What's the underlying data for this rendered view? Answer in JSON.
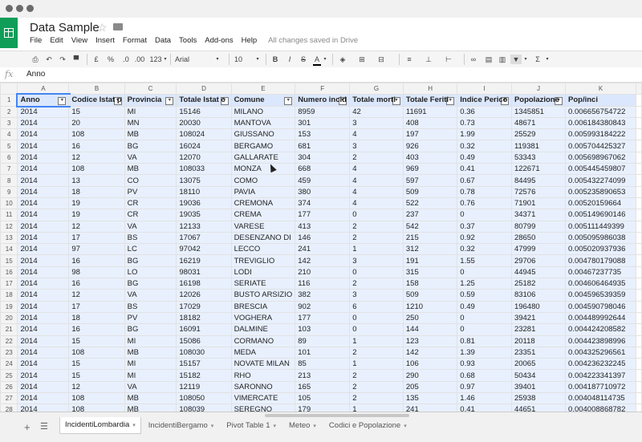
{
  "document": {
    "title": "Data Sample",
    "saved_status": "All changes saved in Drive"
  },
  "menu": [
    "File",
    "Edit",
    "View",
    "Insert",
    "Format",
    "Data",
    "Tools",
    "Add-ons",
    "Help"
  ],
  "toolbar": {
    "currency": "£",
    "percent": "%",
    "decrease_decimals": ".0",
    "increase_decimals": ".00",
    "more_formats": "123",
    "font": "Arial",
    "font_size": "10",
    "bold": "B",
    "italic": "I",
    "strikethrough": "S",
    "text_color": "A",
    "sum": "Σ",
    "accent_color": "#0f9d58"
  },
  "formula_bar": {
    "fx_label": "fx",
    "value": "Anno"
  },
  "grid": {
    "column_letters": [
      "A",
      "B",
      "C",
      "D",
      "E",
      "F",
      "G",
      "H",
      "I",
      "J",
      "K"
    ],
    "headers": [
      "Anno",
      "Codice Istat p",
      "Provincia",
      "Totale Istat c",
      "Comune",
      "Numero incid",
      "Totale morti",
      "Totale Feriti",
      "Indice Perico",
      "Popolazione",
      "Pop/inci"
    ],
    "rows": [
      [
        "2014",
        "15",
        "MI",
        "15146",
        "MILANO",
        "8959",
        "42",
        "11691",
        "0.36",
        "1345851",
        "0.006656754722"
      ],
      [
        "2014",
        "20",
        "MN",
        "20030",
        "MANTOVA",
        "301",
        "3",
        "408",
        "0.73",
        "48671",
        "0.006184380843"
      ],
      [
        "2014",
        "108",
        "MB",
        "108024",
        "GIUSSANO",
        "153",
        "4",
        "197",
        "1.99",
        "25529",
        "0.005993184222"
      ],
      [
        "2014",
        "16",
        "BG",
        "16024",
        "BERGAMO",
        "681",
        "3",
        "926",
        "0.32",
        "119381",
        "0.005704425327"
      ],
      [
        "2014",
        "12",
        "VA",
        "12070",
        "GALLARATE",
        "304",
        "2",
        "403",
        "0.49",
        "53343",
        "0.005698967062"
      ],
      [
        "2014",
        "108",
        "MB",
        "108033",
        "MONZA",
        "668",
        "4",
        "969",
        "0.41",
        "122671",
        "0.005445459807"
      ],
      [
        "2014",
        "13",
        "CO",
        "13075",
        "COMO",
        "459",
        "4",
        "597",
        "0.67",
        "84495",
        "0.005432274099"
      ],
      [
        "2014",
        "18",
        "PV",
        "18110",
        "PAVIA",
        "380",
        "4",
        "509",
        "0.78",
        "72576",
        "0.005235890653"
      ],
      [
        "2014",
        "19",
        "CR",
        "19036",
        "CREMONA",
        "374",
        "4",
        "522",
        "0.76",
        "71901",
        "0.00520159664"
      ],
      [
        "2014",
        "19",
        "CR",
        "19035",
        "CREMA",
        "177",
        "0",
        "237",
        "0",
        "34371",
        "0.005149690146"
      ],
      [
        "2014",
        "12",
        "VA",
        "12133",
        "VARESE",
        "413",
        "2",
        "542",
        "0.37",
        "80799",
        "0.005111449399"
      ],
      [
        "2014",
        "17",
        "BS",
        "17067",
        "DESENZANO DI",
        "146",
        "2",
        "215",
        "0.92",
        "28650",
        "0.005095986038"
      ],
      [
        "2014",
        "97",
        "LC",
        "97042",
        "LECCO",
        "241",
        "1",
        "312",
        "0.32",
        "47999",
        "0.005020937936"
      ],
      [
        "2014",
        "16",
        "BG",
        "16219",
        "TREVIGLIO",
        "142",
        "3",
        "191",
        "1.55",
        "29706",
        "0.004780179088"
      ],
      [
        "2014",
        "98",
        "LO",
        "98031",
        "LODI",
        "210",
        "0",
        "315",
        "0",
        "44945",
        "0.00467237735"
      ],
      [
        "2014",
        "16",
        "BG",
        "16198",
        "SERIATE",
        "116",
        "2",
        "158",
        "1.25",
        "25182",
        "0.004606464935"
      ],
      [
        "2014",
        "12",
        "VA",
        "12026",
        "BUSTO ARSIZIO",
        "382",
        "3",
        "509",
        "0.59",
        "83106",
        "0.004596539359"
      ],
      [
        "2014",
        "17",
        "BS",
        "17029",
        "BRESCIA",
        "902",
        "6",
        "1210",
        "0.49",
        "196480",
        "0.004590798046"
      ],
      [
        "2014",
        "18",
        "PV",
        "18182",
        "VOGHERA",
        "177",
        "0",
        "250",
        "0",
        "39421",
        "0.004489992644"
      ],
      [
        "2014",
        "16",
        "BG",
        "16091",
        "DALMINE",
        "103",
        "0",
        "144",
        "0",
        "23281",
        "0.004424208582"
      ],
      [
        "2014",
        "15",
        "MI",
        "15086",
        "CORMANO",
        "89",
        "1",
        "123",
        "0.81",
        "20118",
        "0.004423898996"
      ],
      [
        "2014",
        "108",
        "MB",
        "108030",
        "MEDA",
        "101",
        "2",
        "142",
        "1.39",
        "23351",
        "0.004325296561"
      ],
      [
        "2014",
        "15",
        "MI",
        "15157",
        "NOVATE MILAN",
        "85",
        "1",
        "106",
        "0.93",
        "20065",
        "0.004236232245"
      ],
      [
        "2014",
        "15",
        "MI",
        "15182",
        "RHO",
        "213",
        "2",
        "290",
        "0.68",
        "50434",
        "0.004223341397"
      ],
      [
        "2014",
        "12",
        "VA",
        "12119",
        "SARONNO",
        "165",
        "2",
        "205",
        "0.97",
        "39401",
        "0.004187710972"
      ],
      [
        "2014",
        "108",
        "MB",
        "108050",
        "VIMERCATE",
        "105",
        "2",
        "135",
        "1.46",
        "25938",
        "0.004048114735"
      ],
      [
        "2014",
        "108",
        "MB",
        "108039",
        "SEREGNO",
        "179",
        "1",
        "241",
        "0.41",
        "44651",
        "0.004008868782"
      ]
    ]
  },
  "sheets": {
    "tabs": [
      "IncidentiLombardia",
      "IncidentiBergamo",
      "Pivot Table 1",
      "Meteo",
      "Codici e Popolazione"
    ],
    "active": "IncidentiLombardia"
  }
}
